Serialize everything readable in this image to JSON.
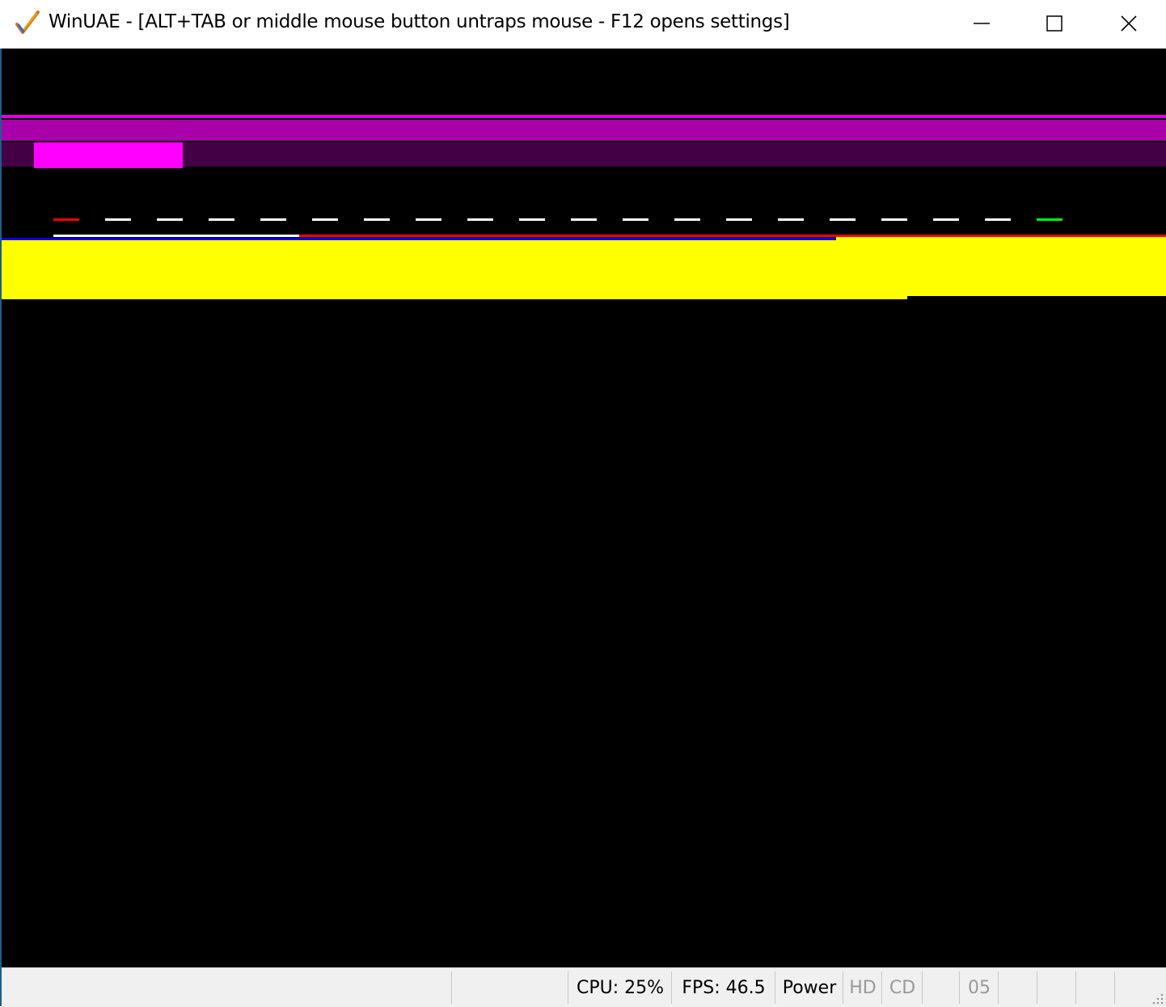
{
  "window": {
    "title": "WinUAE - [ALT+TAB or middle mouse button untraps mouse - F12 opens settings]",
    "icon": "winuae-checkmark-icon",
    "controls": [
      "minimize-icon",
      "maximize-icon",
      "close-icon"
    ]
  },
  "emulator_screen": {
    "background": "#000000",
    "colors": {
      "magenta_line": "#e000e0",
      "purple_band": "#aa00aa",
      "dark_purple_band": "#440044",
      "bright_magenta_block": "#ff00ff",
      "marker_red": "#ff0000",
      "marker_white": "#ffffff",
      "marker_green": "#00ff00",
      "blue_line": "#0000ff",
      "yellow_band": "#ffff00"
    }
  },
  "statusbar": {
    "cpu": "CPU: 25%",
    "fps": "FPS: 46.5",
    "power": "Power",
    "hd": "HD",
    "cd": "CD",
    "drive": "05"
  }
}
